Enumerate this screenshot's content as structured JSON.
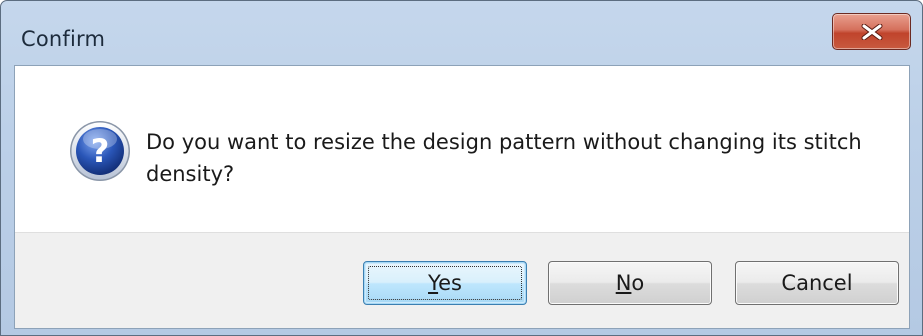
{
  "window": {
    "title": "Confirm"
  },
  "titlebar": {
    "close_icon": "close-x-icon",
    "close_color": "#c9533a"
  },
  "dialog": {
    "icon": "question-icon",
    "icon_color": "#2a56b8",
    "message": "Do you want to resize the design pattern without changing its stitch density?"
  },
  "buttons": {
    "yes": {
      "mnemonic": "Y",
      "rest": "es"
    },
    "no": {
      "mnemonic": "N",
      "rest": "o"
    },
    "cancel": {
      "label": "Cancel"
    }
  }
}
